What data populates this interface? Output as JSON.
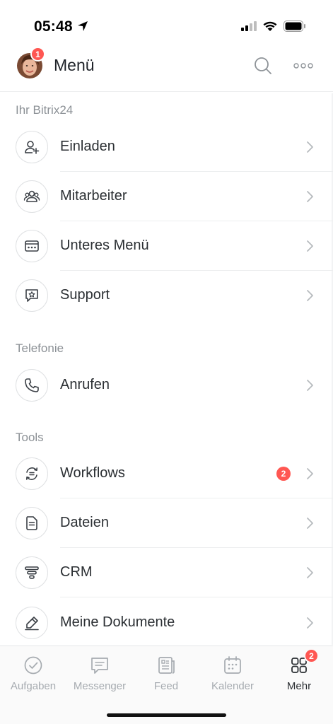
{
  "status": {
    "time": "05:48"
  },
  "header": {
    "title": "Menü",
    "avatar_badge": "1"
  },
  "sections": [
    {
      "title": "Ihr Bitrix24",
      "items": [
        {
          "label": "Einladen",
          "icon": "add-user-icon"
        },
        {
          "label": "Mitarbeiter",
          "icon": "people-icon"
        },
        {
          "label": "Unteres Menü",
          "icon": "bottom-menu-icon"
        },
        {
          "label": "Support",
          "icon": "support-chat-icon"
        }
      ]
    },
    {
      "title": "Telefonie",
      "items": [
        {
          "label": "Anrufen",
          "icon": "phone-icon"
        }
      ]
    },
    {
      "title": "Tools",
      "items": [
        {
          "label": "Workflows",
          "icon": "workflow-icon",
          "badge": "2"
        },
        {
          "label": "Dateien",
          "icon": "file-icon"
        },
        {
          "label": "CRM",
          "icon": "crm-funnel-icon"
        },
        {
          "label": "Meine Dokumente",
          "icon": "sign-document-icon"
        }
      ]
    }
  ],
  "tabs": [
    {
      "label": "Aufgaben",
      "icon": "check-circle-icon"
    },
    {
      "label": "Messenger",
      "icon": "chat-icon"
    },
    {
      "label": "Feed",
      "icon": "feed-icon"
    },
    {
      "label": "Kalender",
      "icon": "calendar-icon"
    },
    {
      "label": "Mehr",
      "icon": "grid-icon",
      "badge": "2",
      "active": true
    }
  ],
  "colors": {
    "badge": "#ff5752",
    "text": "#2b2f33",
    "muted": "#8c9196",
    "icon": "#3a3f45"
  }
}
